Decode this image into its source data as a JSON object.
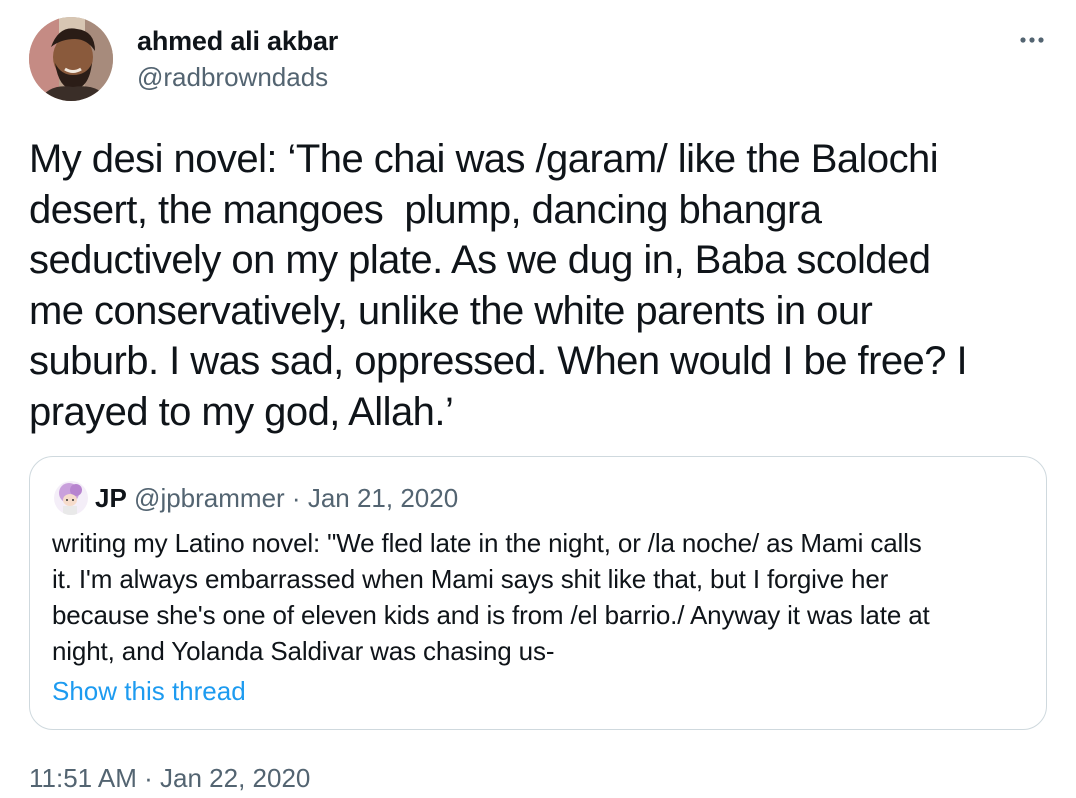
{
  "tweet": {
    "author": {
      "display_name": "ahmed ali akbar",
      "handle": "@radbrowndads",
      "avatar_icon": "profile-photo"
    },
    "more_icon": "ellipsis-icon",
    "text": "My desi novel: ‘The chai was /garam/ like the Balochi\ndesert, the mangoes  plump, dancing bhangra\nseductively on my plate. As we dug in, Baba scolded\nme conservatively, unlike the white parents in our\nsuburb. I was sad, oppressed. When would I be free? I\nprayed to my god, Allah.’",
    "timestamp": "11:51 AM · Jan 22, 2020"
  },
  "quote": {
    "name": "JP",
    "handle": "@jpbrammer",
    "separator": " · ",
    "date": "Jan 21, 2020",
    "text": "writing my Latino novel: \"We fled late in the night, or /la noche/ as Mami calls\nit. I'm always embarrassed when Mami says shit like that, but I forgive her\nbecause she's one of eleven kids and is from /el barrio./ Anyway it was late at\nnight, and Yolanda Saldivar was chasing us-",
    "show_thread_label": "Show this thread"
  },
  "colors": {
    "text_primary": "#0f1419",
    "text_secondary": "#536471",
    "link": "#1d9bf0",
    "border": "#cfd9de"
  }
}
